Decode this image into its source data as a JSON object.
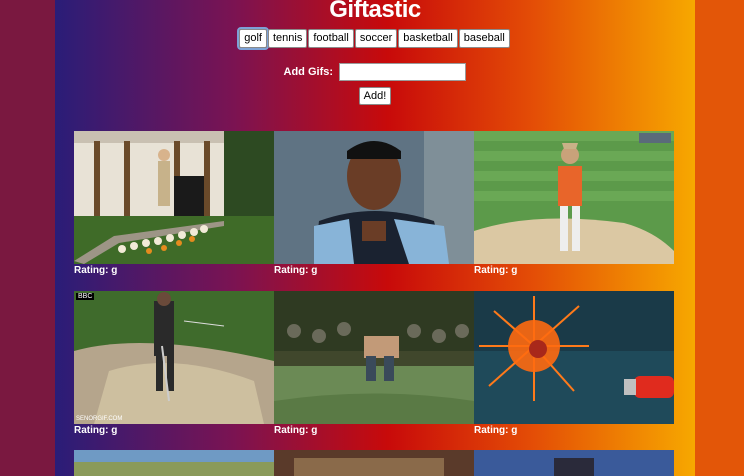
{
  "app": {
    "title": "Giftastic"
  },
  "topics": [
    {
      "label": "golf",
      "active": true
    },
    {
      "label": "tennis"
    },
    {
      "label": "football"
    },
    {
      "label": "soccer"
    },
    {
      "label": "basketball"
    },
    {
      "label": "baseball"
    }
  ],
  "add_form": {
    "label": "Add Gifs:",
    "value": "",
    "submit_label": "Add!"
  },
  "gifs": [
    {
      "rating": "Rating: g"
    },
    {
      "rating": "Rating: g"
    },
    {
      "rating": "Rating: g"
    },
    {
      "rating": "Rating: g"
    },
    {
      "rating": "Rating: g"
    },
    {
      "rating": "Rating: g"
    }
  ],
  "gif_overlays": {
    "bbc_logo": "BBC",
    "watermark_left": "SENORGIF.COM"
  }
}
